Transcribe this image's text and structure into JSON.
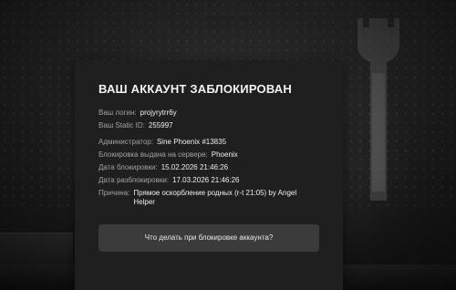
{
  "ban_card": {
    "title": "ВАШ АККАУНТ ЗАБЛОКИРОВАН",
    "account": {
      "login_label": "Ваш логин:",
      "login_value": "projyrytrr6y",
      "static_id_label": "Ваш Static ID:",
      "static_id_value": "255997"
    },
    "details": {
      "admin_label": "Администратор:",
      "admin_value": "Sine Phoenix #13835",
      "server_label": "Блокировка выдана на сервере:",
      "server_value": "Phoenix",
      "ban_date_label": "Дата блокировки:",
      "ban_date_value": "15.02.2026 21:46:26",
      "unban_date_label": "Дата разблокировки:",
      "unban_date_value": "17.03.2026 21:46:26",
      "reason_label": "Причина:",
      "reason_value": "Прямое оскорбление родных (r-t 21:05) by Angel Helper"
    },
    "help_button_label": "Что делать при блокировке аккаунта?"
  }
}
